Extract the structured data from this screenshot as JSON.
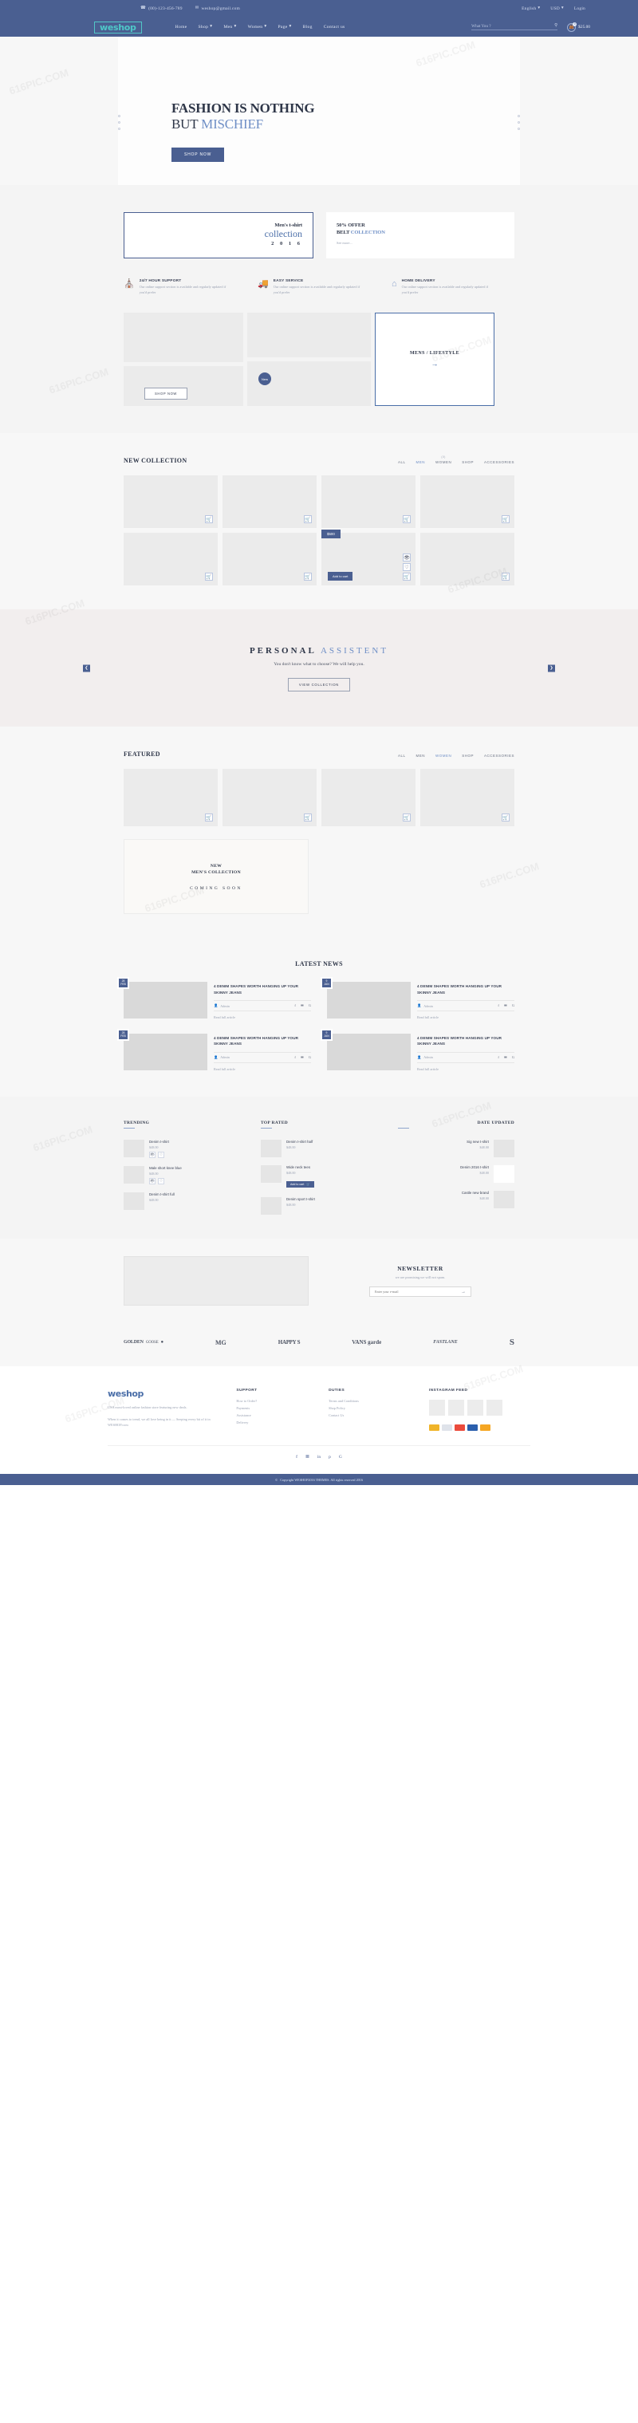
{
  "topbar": {
    "phone": "& (00)-123-456-789",
    "phone_text": "(00)-123-456-789",
    "email": "weshop@gmail.com",
    "language": "English",
    "currency": "USD",
    "login": "Login"
  },
  "brand": {
    "logo": "weshop"
  },
  "nav": {
    "items": [
      {
        "label": "Home",
        "caret": false
      },
      {
        "label": "Shop",
        "caret": true
      },
      {
        "label": "Men",
        "caret": true
      },
      {
        "label": "Women",
        "caret": true
      },
      {
        "label": "Page",
        "caret": true
      },
      {
        "label": "Blog",
        "caret": false
      },
      {
        "label": "Contact us",
        "caret": false
      }
    ]
  },
  "search": {
    "placeholder": "What You ?",
    "value": ""
  },
  "cart": {
    "count": "0",
    "total": "$25.00"
  },
  "hero": {
    "line1": "FASHION IS NOTHING",
    "line2_a": "BUT ",
    "line2_b": "MISCHIEF",
    "cta": "SHOP NOW"
  },
  "promos": [
    {
      "small": "Men's t-shirt",
      "big": "collection",
      "year": "2 0 1 6"
    },
    {
      "title_a": "50% OFFER",
      "title_b": "BELT ",
      "title_c": "COLLECTION",
      "link": "See more..."
    }
  ],
  "features": [
    {
      "icon": "headset-icon",
      "glyph": "☎",
      "title": "24/7 HOUR SUPPORT",
      "desc": "Our online support section is available and regularly updated if you'd prefer"
    },
    {
      "icon": "truck-icon",
      "glyph": "✉",
      "title": "EASY SERVICE",
      "desc": "Our online support section is available and regularly updated if you'd prefer"
    },
    {
      "icon": "home-icon",
      "glyph": "⌂",
      "title": "HOME DELIVERY",
      "desc": "Our online support section is available and regularly updated if you'd prefer"
    }
  ],
  "categories": {
    "shop_now": "SHOP NOW",
    "new_badge": "New",
    "mens_lifestyle": "MENS / LIFESTYLE",
    "arrow": "→"
  },
  "new_collection": {
    "title": "NEW COLLECTION",
    "filters": [
      {
        "label": "ALL",
        "active": false,
        "badge": ""
      },
      {
        "label": "MEN",
        "active": true,
        "badge": ""
      },
      {
        "label": "WOMEN",
        "active": false,
        "badge": "(0)"
      },
      {
        "label": "SHOP",
        "active": false,
        "badge": ""
      },
      {
        "label": "ACCESSORIES",
        "active": false,
        "badge": ""
      }
    ],
    "price_badge": "$500",
    "add_to_cart": "Add to cart"
  },
  "assistant": {
    "title_a": "PERSONAL ",
    "title_b": "ASSISTENT",
    "subtitle": "You don't know what to choose? We will help you.",
    "cta": "VIEW COLLECTION",
    "prev": "❮",
    "next": "❯"
  },
  "featured": {
    "title": "FEATURED",
    "filters": [
      {
        "label": "ALL",
        "active": false
      },
      {
        "label": "MEN",
        "active": false
      },
      {
        "label": "WOMEN",
        "active": true
      },
      {
        "label": "SHOP",
        "active": false
      },
      {
        "label": "ACCESSORIES",
        "active": false
      }
    ]
  },
  "coming_soon": {
    "line1": "NEW",
    "line2": "MEN'S COLLECTION",
    "line3": "COMING SOON"
  },
  "news": {
    "title": "LATEST NEWS",
    "items": [
      {
        "day": "28",
        "month": "FEB",
        "heading": "4 DENIM SHAPES WORTH HANGING UP YOUR SKINNY JEANS",
        "author": "Admin",
        "more": "Read full article"
      },
      {
        "day": "9",
        "month": "JAN",
        "heading": "4 DENIM SHAPES WORTH HANGING UP YOUR SKINNY JEANS",
        "author": "Admin",
        "more": "Read full article"
      },
      {
        "day": "28",
        "month": "FEB",
        "heading": "4 DENIM SHAPES WORTH HANGING UP YOUR SKINNY JEANS",
        "author": "Admin",
        "more": "Read full article"
      },
      {
        "day": "9",
        "month": "JAN",
        "heading": "4 DENIM SHAPES WORTH HANGING UP YOUR SKINNY JEANS",
        "author": "Admin",
        "more": "Read full article"
      }
    ]
  },
  "lists": [
    {
      "heading": "TRENDING",
      "items": [
        {
          "name": "Denim t-shirt",
          "price": "$48.00",
          "has_icons": true,
          "has_add": false
        },
        {
          "name": "Male short knee blue",
          "price": "$48.00",
          "has_icons": true,
          "has_add": false
        },
        {
          "name": "Denim t-shirt full",
          "price": "$48.00",
          "has_icons": false,
          "has_add": false
        }
      ]
    },
    {
      "heading": "TOP RATED",
      "items": [
        {
          "name": "Denim t-shirt half",
          "price": "$48.00",
          "has_icons": false,
          "has_add": false
        },
        {
          "name": "Wide neck tees",
          "price": "$48.00",
          "has_icons": false,
          "has_add": true
        },
        {
          "name": "Denim sport t-shirt",
          "price": "$48.00",
          "has_icons": false,
          "has_add": false
        }
      ]
    },
    {
      "heading": "DATE UPDATED",
      "items": [
        {
          "name": "Sig new t-shirt",
          "price": "$48.00",
          "has_icons": false,
          "has_add": false
        },
        {
          "name": "Denim 2016 t-shirt",
          "price": "$48.00",
          "has_icons": false,
          "has_add": false
        },
        {
          "name": "Castle new brand",
          "price": "$48.00",
          "has_icons": false,
          "has_add": false
        }
      ]
    }
  ],
  "newsletter": {
    "title": "NEWSLETTER",
    "subtitle": "we are promising,we will not spam.",
    "placeholder": "Enter your e-mail",
    "value": "",
    "submit": "→"
  },
  "brands": [
    {
      "name": "GOLDEN GOOSE",
      "text": "GOLDEN",
      "sub": "GOOSE"
    },
    {
      "name": "MG",
      "text": "MG"
    },
    {
      "name": "HAPPY SOCKS",
      "text": "HAPPY S"
    },
    {
      "name": "VANS GARDE",
      "text": "VANS garde"
    },
    {
      "name": "FASTLANE",
      "text": "FASTLANE"
    },
    {
      "name": "S",
      "text": "S"
    }
  ],
  "footer": {
    "logo": "weshop",
    "about_1": "USA most-loved online fashion store featuring new deals.",
    "about_2": "When it comes to trend, we all love being in it — Seeping every bit of it in WESHOP.com",
    "columns": [
      {
        "heading": "SUPPORT",
        "links": [
          "How to Order?",
          "Payments",
          "Assistance",
          "Delivery"
        ]
      },
      {
        "heading": "DUTIES",
        "links": [
          "Terms and Conditions",
          "Shop Policy",
          "Contact Us"
        ]
      }
    ],
    "instagram_heading": "INSTAGRAM FEED",
    "social": [
      "f",
      "t",
      "in",
      "p",
      "g"
    ]
  },
  "copyright": "Copyright WESHOP2016 THEMES. All rights reserved 2016",
  "colors": {
    "brand_blue": "#4a5f91",
    "accent_light_blue": "#6f8fc6",
    "logo_teal": "#4ec8c8",
    "page_grey": "#f4f4f4",
    "assist_bg": "#f2eeee"
  }
}
